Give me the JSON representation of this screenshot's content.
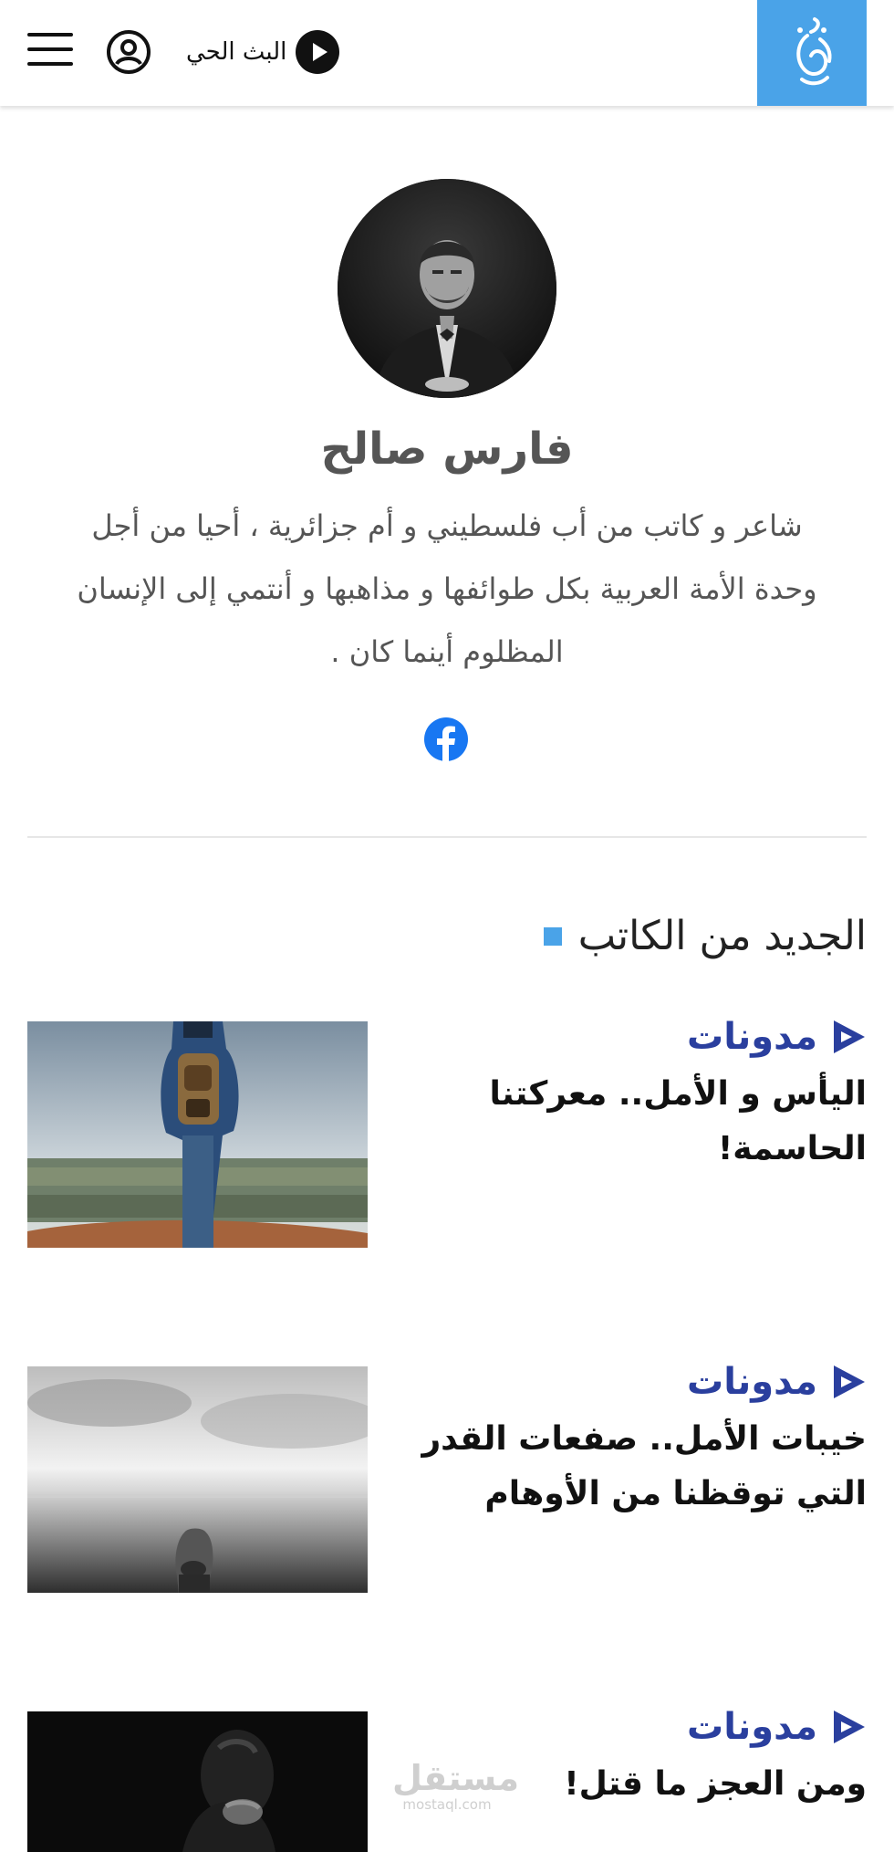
{
  "header": {
    "live_label": "البث الحي"
  },
  "author": {
    "name": "فارس صالح",
    "bio": "شاعر و كاتب من أب فلسطيني و أم جزائرية ، أحيا من أجل وحدة الأمة العربية بكل طوائفها و مذاهبها و أنتمي إلى الإنسان المظلوم أينما كان ."
  },
  "section": {
    "title": "الجديد من الكاتب"
  },
  "articles": [
    {
      "category": "مدونات",
      "title": "اليأس و الأمل.. معركتنا الحاسمة!"
    },
    {
      "category": "مدونات",
      "title": "خيبات الأمل.. صفعات القدر التي توقظنا من الأوهام"
    },
    {
      "category": "مدونات",
      "title": "ومن العجز ما قتل!"
    }
  ],
  "watermark": {
    "arabic": "مستقل",
    "latin": "mostaql.com"
  },
  "colors": {
    "brand_blue": "#4aa3e8",
    "category_blue": "#2a3f9e",
    "facebook_blue": "#1877f2"
  }
}
